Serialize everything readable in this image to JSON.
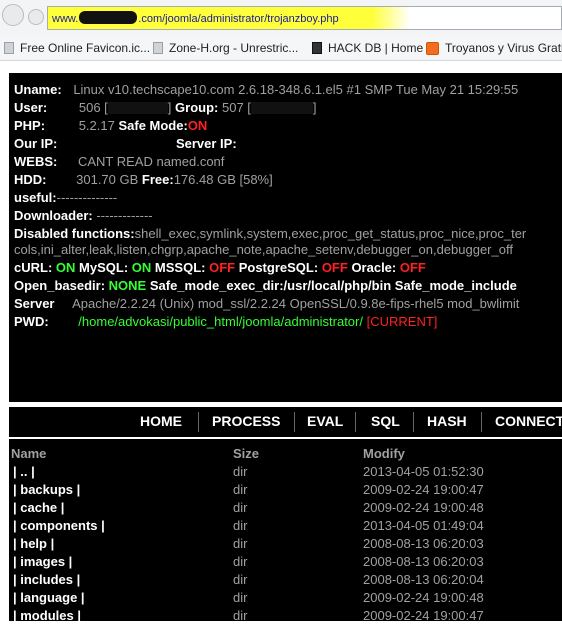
{
  "browser": {
    "url_prefix": "www.",
    "url_suffix": ".com/joomla/administrator/trojanzboy.php",
    "url_highlight_color": "#ffff3a"
  },
  "bookmarks": [
    {
      "label": "Free Online Favicon.ic...",
      "icon": "page-icon"
    },
    {
      "label": "Zone-H.org - Unrestric...",
      "icon": "zone-h-icon"
    },
    {
      "label": "HACK DB | Home",
      "icon": "hackdb-icon"
    },
    {
      "label": "Troyanos y Virus Gratis",
      "icon": "blogger-icon"
    }
  ],
  "info": {
    "uname_label": "Uname:",
    "uname_value": "Linux v10.techscape10.com 2.6.18-348.6.1.el5 #1 SMP Tue May 21 15:29:55",
    "user_label": "User:",
    "user_value": "506 [",
    "user_close": "]",
    "group_label": "Group:",
    "group_value": "507 [",
    "group_close": "]",
    "php_label": "PHP:",
    "php_value": "5.2.17",
    "safemode_label": "Safe Mode:",
    "safemode_value": "ON",
    "ourip_label": "Our IP:",
    "serverip_label": "Server IP:",
    "webs_label": "WEBS:",
    "webs_value": "CANT READ named.conf",
    "hdd_label": "HDD:",
    "hdd_value": "301.70 GB",
    "free_label": "Free:",
    "free_value": "176.48 GB [58%]",
    "useful_label": "useful:",
    "useful_value": "--------------",
    "downloader_label": "Downloader:",
    "downloader_value": "-------------",
    "disabled_label": "Disabled functions:",
    "disabled_line1": "shell_exec,symlink,system,exec,proc_get_status,proc_nice,proc_ter",
    "disabled_line2": "cols,ini_alter,leak,listen,chgrp,apache_note,apache_setenv,debugger_on,debugger_off",
    "curl_label": "cURL:",
    "curl_value": "ON",
    "mysql_label": "MySQL:",
    "mysql_value": "ON",
    "mssql_label": "MSSQL:",
    "mssql_value": "OFF",
    "pgsql_label": "PostgreSQL:",
    "pgsql_value": "OFF",
    "oracle_label": "Oracle:",
    "oracle_value": "OFF",
    "openbasedir_label": "Open_basedir:",
    "openbasedir_value": "NONE",
    "safeexec_label": "Safe_mode_exec_dir:",
    "safeexec_value": "/usr/local/php/bin",
    "safeinclude_label": "Safe_mode_include",
    "server_label": "Server",
    "server_value": "Apache/2.2.24 (Unix) mod_ssl/2.2.24 OpenSSL/0.9.8e-fips-rhel5 mod_bwlimit",
    "pwd_label": "PWD:",
    "pwd_value": "/home/advokasi/public_html/joomla/administrator/",
    "pwd_current": "[CURRENT]"
  },
  "menu": [
    "HOME",
    "PROCESS",
    "EVAL",
    "SQL",
    "HASH",
    "CONNECT"
  ],
  "files": {
    "headers": {
      "name": "Name",
      "size": "Size",
      "modify": "Modify"
    },
    "rows": [
      {
        "name": "| .. |",
        "size": "dir",
        "modify": "2013-04-05 01:52:30"
      },
      {
        "name": "| backups |",
        "size": "dir",
        "modify": "2009-02-24 19:00:47"
      },
      {
        "name": "| cache |",
        "size": "dir",
        "modify": "2009-02-24 19:00:48"
      },
      {
        "name": "| components |",
        "size": "dir",
        "modify": "2013-04-05 01:49:04"
      },
      {
        "name": "| help |",
        "size": "dir",
        "modify": "2008-08-13 06:20:03"
      },
      {
        "name": "| images |",
        "size": "dir",
        "modify": "2008-08-13 06:20:03"
      },
      {
        "name": "| includes |",
        "size": "dir",
        "modify": "2008-08-13 06:20:04"
      },
      {
        "name": "| language |",
        "size": "dir",
        "modify": "2009-02-24 19:00:48"
      },
      {
        "name": "| modules |",
        "size": "dir",
        "modify": "2009-02-24 19:00:47"
      }
    ]
  }
}
